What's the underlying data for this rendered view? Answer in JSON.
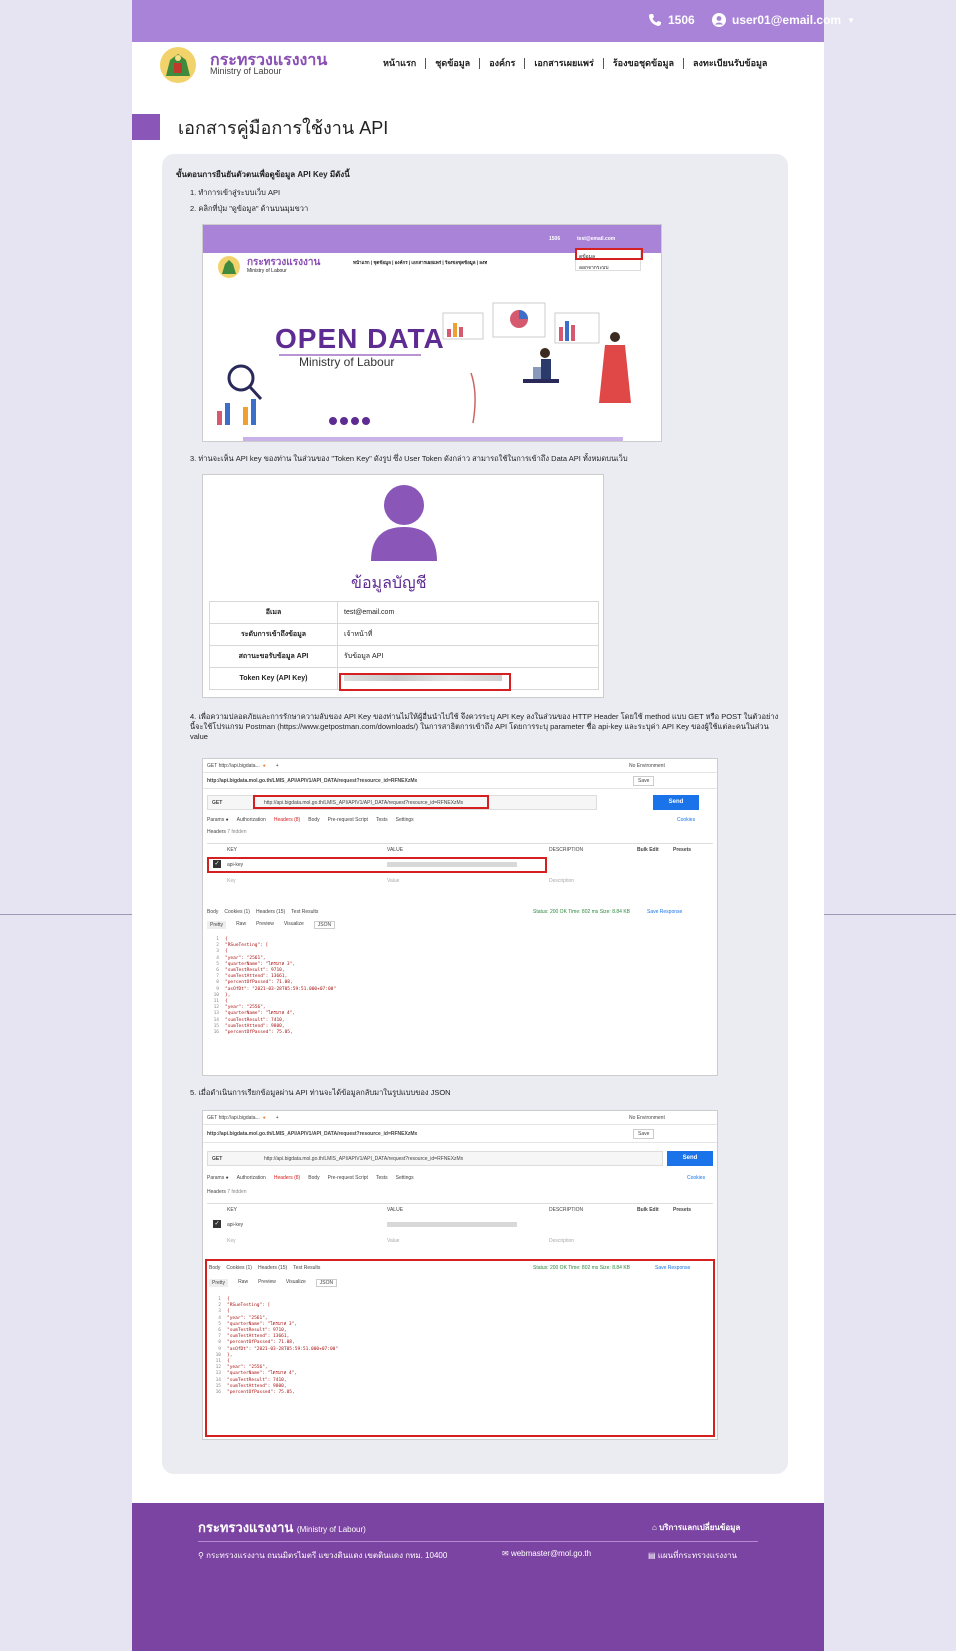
{
  "topbar": {
    "phone": "1506",
    "user": "user01@email.com"
  },
  "brand": {
    "th": "กระทรวงแรงงาน",
    "en": "Ministry of Labour"
  },
  "nav": [
    "หน้าแรก",
    "ชุดข้อมูล",
    "องค์กร",
    "เอกสารเผยแพร่",
    "ร้องขอชุดข้อมูล",
    "ลงทะเบียนรับข้อมูล"
  ],
  "page_title": "เอกสารคู่มือการใช้งาน API",
  "guide": {
    "heading": "ขั้นตอนการยืนยันตัวตนเพื่อดูข้อมูล API Key มีดังนี้",
    "step1": "1. ทำการเข้าสู่ระบบเว็บ API",
    "step2": "2. คลิกที่ปุ่ม \"ดูข้อมูล\" ด้านบนมุมขวา",
    "step3": "3. ท่านจะเห็น API key ของท่าน ในส่วนของ \"Token Key\" ดังรูป ซึ่ง User Token ดังกล่าว สามารถใช้ในการเข้าถึง Data API ทั้งหมดบนเว็บ",
    "step4": "4. เพื่อความปลอดภัยและการรักษาความลับของ API Key ของท่านไม่ให้ผู้อื่นนำไปใช้ จึงควรระบุ API Key ลงในส่วนของ HTTP Header โดยใช้ method แบบ GET หรือ POST ในตัวอย่างนี้จะใช้โปรแกรม Postman (https://www.getpostman.com/downloads/) ในการสาธิตการเข้าถึง API โดยการระบุ parameter ชื่อ api-key และระบุค่า API Key ของผู้ใช้แต่ละคนในส่วน value",
    "step5": "5. เมื่อดำเนินการเรียกข้อมูลผ่าน API ท่านจะได้ข้อมูลกลับมาในรูปแบบของ JSON"
  },
  "shot1": {
    "phone": "1506",
    "user": "test@email.com",
    "brand_th": "กระทรวงแรงงาน",
    "brand_en": "Ministry of Labour",
    "nav": "หน้าแรก | ชุดข้อมูล | องค์กร | เอกสารเผยแพร่ | ร้องขอชุดข้อมูล | ลงท",
    "menu1": "ดูข้อมูล",
    "menu2": "ออกจากระบบ",
    "hero_title": "OPEN DATA",
    "hero_sub": "Ministry of Labour"
  },
  "account": {
    "title": "ข้อมูลบัญชี",
    "rows": [
      {
        "k": "อีเมล",
        "v": "test@email.com"
      },
      {
        "k": "ระดับการเข้าถึงข้อมูล",
        "v": "เจ้าหน้าที่"
      },
      {
        "k": "สถานะขอรับข้อมูล API",
        "v": "รับข้อมูล API"
      },
      {
        "k": "Token Key (API Key)",
        "v": ""
      }
    ]
  },
  "postman": {
    "tab": "GET http://api.bigdata...",
    "env": "No Environment",
    "title_url": "http://api.bigdata.mol.go.th/LMIS_API/APIV1/API_DATA/request?resource_id=RFNEXzMx",
    "save": "Save",
    "method": "GET",
    "url": "http://api.bigdata.mol.go.th/LMIS_API/APIV1/API_DATA/request?resource_id=RFNEXzMx",
    "send": "Send",
    "tabs": [
      "Params ●",
      "Authorization",
      "Headers (8)",
      "Body",
      "Pre-request Script",
      "Tests",
      "Settings"
    ],
    "cookies": "Cookies",
    "headers_label": "Headers",
    "hidden": "7 hidden",
    "cols": [
      "KEY",
      "VALUE",
      "DESCRIPTION"
    ],
    "bulk": "Bulk Edit",
    "presets": "Presets",
    "key": "api-key",
    "key_ph": "Key",
    "value_ph": "Value",
    "desc_ph": "Description",
    "resp_tabs": [
      "Body",
      "Cookies (1)",
      "Headers (15)",
      "Test Results"
    ],
    "status": "Status: 200 OK   Time: 802 ms   Size: 8.84 KB",
    "save_resp": "Save Response",
    "views": [
      "Pretty",
      "Raw",
      "Preview",
      "Visualize",
      "JSON"
    ],
    "code": [
      "{",
      "    \"RSueTesting\": [",
      "        {",
      "            \"year\": \"2561\",",
      "            \"quarterName\": \"ไตรมาส 3\",",
      "            \"sumTestResult\": 9710,",
      "            \"sumTestAttend\": 13661,",
      "            \"percentOfPassed\": 71.08,",
      "            \"asOfDt\": \"2021-03-28T05:59:51.000+07:00\"",
      "        },",
      "        {",
      "            \"year\": \"2556\",",
      "            \"quarterName\": \"ไตรมาส 4\",",
      "            \"sumTestResult\": 7410,",
      "            \"sumTestAttend\": 9800,",
      "            \"percentOfPassed\": 75.05,"
    ]
  },
  "footer": {
    "title": "กระทรวงแรงงาน",
    "title_en": "(Ministry of Labour)",
    "service": "บริการแลกเปลี่ยนข้อมูล",
    "address": "กระทรวงแรงงาน ถนนมิตรไมตรี แขวงดินแดง เขตดินแดง กทม. 10400",
    "email": "webmaster@mol.go.th",
    "map": "แผนที่กระทรวงแรงงาน"
  },
  "colors": {
    "brand": "#a983d8",
    "accent": "#7c44a2",
    "highlight": "#d62020"
  }
}
